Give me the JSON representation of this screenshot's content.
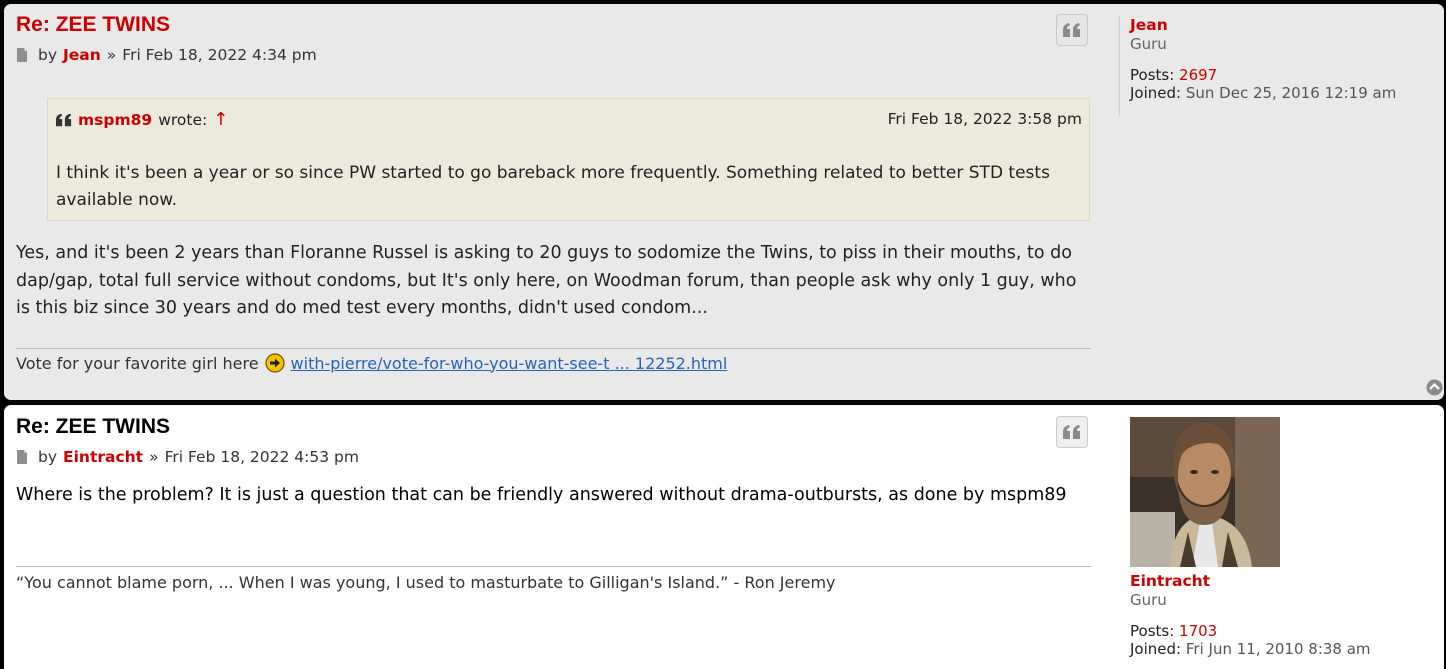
{
  "posts": [
    {
      "title": "Re: ZEE TWINS",
      "by_label": "by",
      "author": "Jean",
      "separator": "»",
      "date": "Fri Feb 18, 2022 4:34 pm",
      "quote": {
        "author": "mspm89",
        "wrote_label": "wrote:",
        "arrow": "↑",
        "date": "Fri Feb 18, 2022 3:58 pm",
        "text": "I think it's been a year or so since PW started to go bareback more frequently. Something related to better STD tests available now."
      },
      "body": "Yes, and it's been 2 years than Floranne Russel is asking to 20 guys to sodomize the Twins, to piss in their mouths, to do dap/gap, total full service without condoms, but It's only here, on Woodman forum, than people ask why only 1 guy, who is this biz since 30 years and do med test every months, didn't used condom...",
      "signature": {
        "text": "Vote for your favorite girl here",
        "link": "with-pierre/vote-for-who-you-want-see-t ... 12252.html"
      },
      "profile": {
        "username": "Jean",
        "rank": "Guru",
        "posts_label": "Posts:",
        "posts": "2697",
        "joined_label": "Joined:",
        "joined": "Sun Dec 25, 2016 12:19 am"
      }
    },
    {
      "title": "Re: ZEE TWINS",
      "by_label": "by",
      "author": "Eintracht",
      "separator": "»",
      "date": "Fri Feb 18, 2022 4:53 pm",
      "body": "Where is the problem? It is just a question that can be friendly answered without drama-outbursts, as done by mspm89",
      "signature": {
        "text": "“You cannot blame porn, ... When I was young, I used to masturbate to Gilligan's Island.” - Ron Jeremy"
      },
      "profile": {
        "username": "Eintracht",
        "rank": "Guru",
        "posts_label": "Posts:",
        "posts": "1703",
        "joined_label": "Joined:",
        "joined": "Fri Jun 11, 2010 8:38 am"
      }
    }
  ],
  "icons": {
    "post": "document-icon",
    "quote_button": "quote-icon",
    "quote_head": "quote-icon",
    "signature_arrow": "arrow-right-circle-icon",
    "top": "arrow-up-circle-icon"
  },
  "colors": {
    "accent": "#cc0000",
    "link": "#2563b8",
    "post_bg_1": "#e9e9e9",
    "post_bg_2": "#ffffff",
    "quote_bg": "#ebeadb"
  }
}
